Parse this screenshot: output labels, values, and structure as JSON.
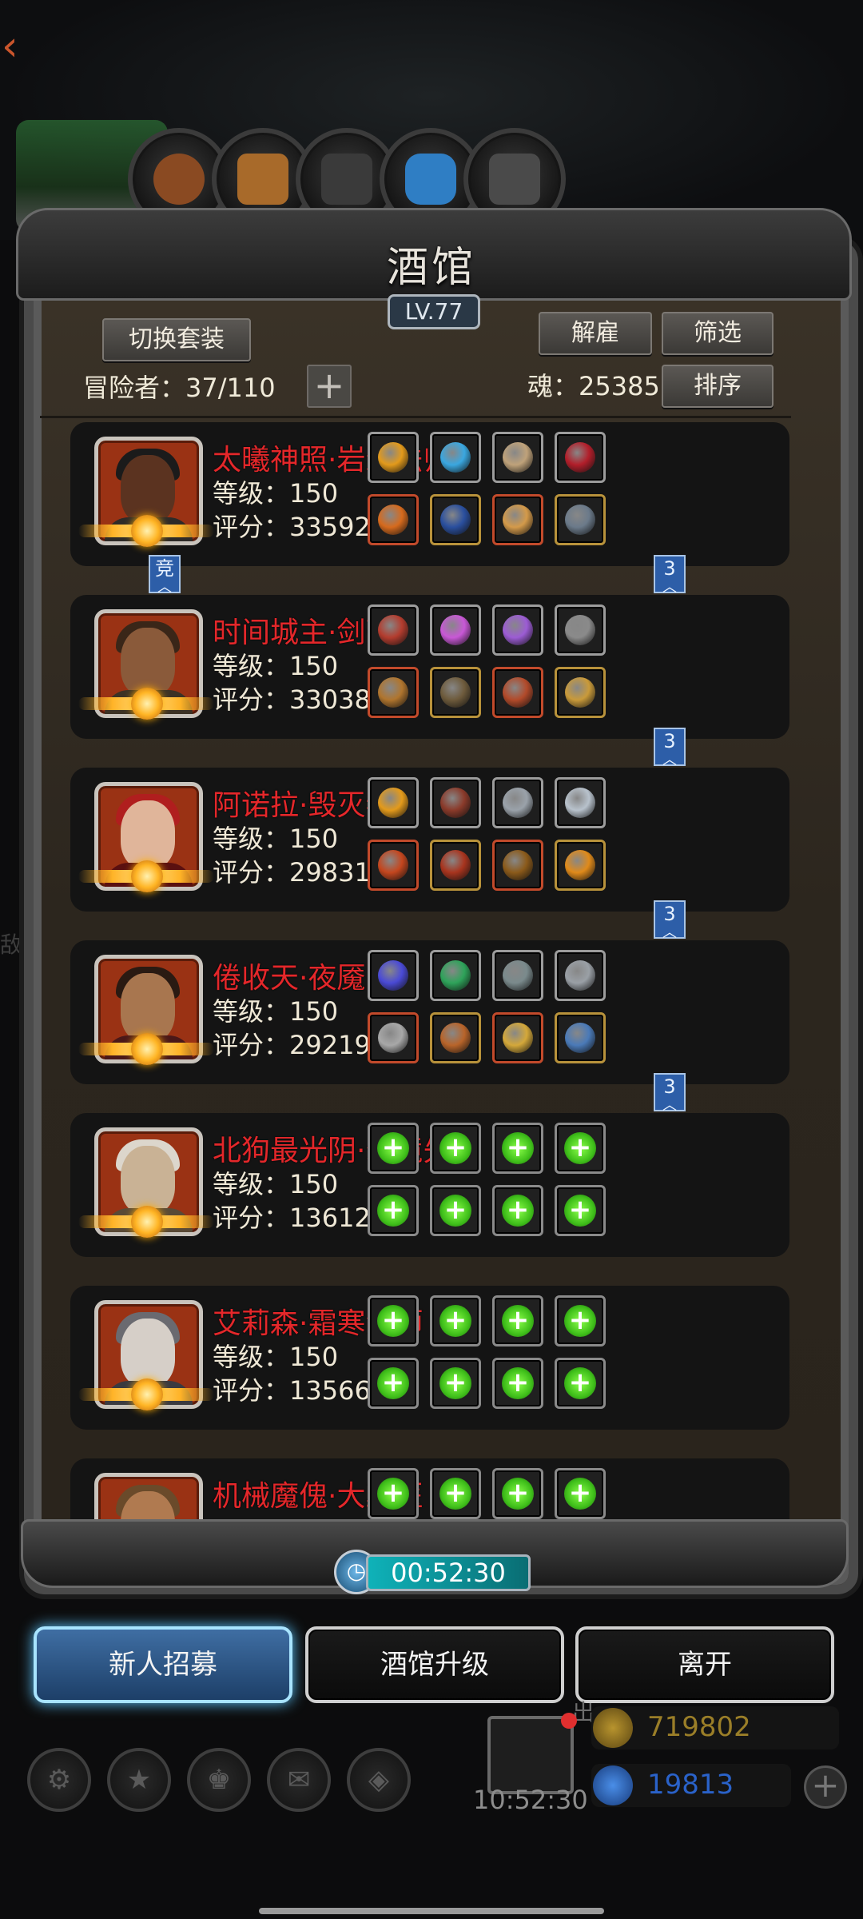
{
  "tavern": {
    "title": "酒馆",
    "level": "LV.77",
    "switch_outfit_label": "切换套装",
    "dismiss_label": "解雇",
    "filter_label": "筛选",
    "sort_label": "排序",
    "adventurers_label": "冒险者：37/110",
    "soul_label": "魂：25385"
  },
  "heroes": [
    {
      "name": "太曦神照·岩浆法师",
      "level": "等级：150",
      "score": "评分：33592",
      "badge_left": "竞",
      "badge_right": "3",
      "skin": "#5b3320",
      "hair": "#1b1b1b",
      "body": "#2e2b28",
      "gear": [
        "#e39a1b",
        "#3aa7e0",
        "#bfa27a",
        "#b21e2a",
        "#d66a1d",
        "#2a4f9e",
        "#d49a4a",
        "#6b7a8a"
      ]
    },
    {
      "name": "时间城主·剑豪",
      "level": "等级：150",
      "score": "评分：33038",
      "badge_right": "3",
      "skin": "#8a5a3a",
      "hair": "#3a2618",
      "body": "#3c3225",
      "gear": [
        "#b33c2e",
        "#c858d6",
        "#9c5cd4",
        "#8a8a8a",
        "#b0752e",
        "#6e5b3c",
        "#b24a2a",
        "#c99a3a"
      ]
    },
    {
      "name": "阿诺拉·毁灭者",
      "level": "等级：150",
      "score": "评分：29831",
      "badge_right": "3",
      "skin": "#e0b59a",
      "hair": "#b01e1e",
      "body": "#5a1010",
      "gear": [
        "#e39a1b",
        "#8a3a2a",
        "#9aa2aa",
        "#b8c2cc",
        "#c4461e",
        "#a8341e",
        "#8b5a1a",
        "#e08a1a"
      ]
    },
    {
      "name": "倦收天·夜魇",
      "level": "等级：150",
      "score": "评分：29219",
      "badge_right": "3",
      "skin": "#a8764f",
      "hair": "#2a1a12",
      "body": "#4a1818",
      "gear": [
        "#4a4ad6",
        "#2ea35a",
        "#7a8a8c",
        "#9aa0a6",
        "#a8a8a8",
        "#b8642a",
        "#d4a83a",
        "#4a7ab8"
      ]
    },
    {
      "name": "北狗最光阴·幻境先知",
      "level": "等级：150",
      "score": "评分：13612",
      "empty": true,
      "skin": "#c9b295",
      "hair": "#dcd6cc",
      "body": "#5a4a36"
    },
    {
      "name": "艾莉森·霜寒法师",
      "level": "等级：150",
      "score": "评分：13566",
      "empty": true,
      "skin": "#d6cfc8",
      "hair": "#6a6a70",
      "body": "#3a3a40"
    },
    {
      "name": "机械魔傀·大巫医",
      "level": "",
      "score": "",
      "empty": true,
      "skin": "#b07a50",
      "hair": "#6a4a2a",
      "body": "#3a2a1a"
    }
  ],
  "footer": {
    "timer": "00:52:30",
    "recruit_label": "新人招募",
    "upgrade_label": "酒馆升级",
    "leave_label": "离开",
    "gift_timer": "10:52:30",
    "gold": "719802",
    "gems": "19813",
    "out_label": "出"
  },
  "colors": {
    "accent_red": "#e4272a",
    "gold": "#b89a2a",
    "gem_blue": "#2a62c9",
    "recruit_active": "#5cc6ff"
  }
}
